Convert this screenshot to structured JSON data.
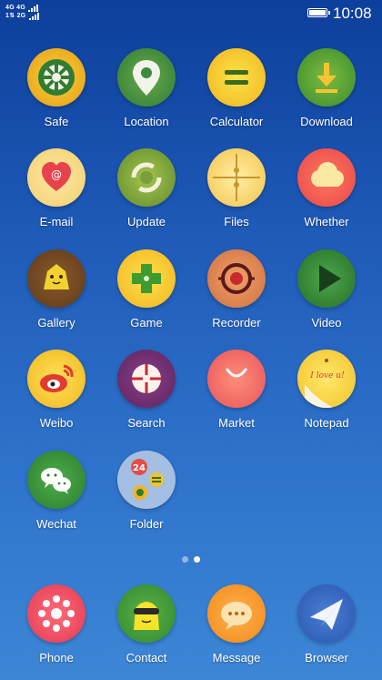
{
  "status_bar": {
    "network_top": "4G 4G",
    "network_bottom": "1⇅ 2G",
    "time": "10:08"
  },
  "apps": [
    {
      "label": "Safe",
      "icon": "safe-icon"
    },
    {
      "label": "Location",
      "icon": "location-pin-icon"
    },
    {
      "label": "Calculator",
      "icon": "calculator-icon"
    },
    {
      "label": "Download",
      "icon": "download-icon"
    },
    {
      "label": "E-mail",
      "icon": "email-heart-icon"
    },
    {
      "label": "Update",
      "icon": "update-icon"
    },
    {
      "label": "Files",
      "icon": "files-icon"
    },
    {
      "label": "Whether",
      "icon": "cloud-icon"
    },
    {
      "label": "Gallery",
      "icon": "gallery-icon"
    },
    {
      "label": "Game",
      "icon": "gamepad-icon"
    },
    {
      "label": "Recorder",
      "icon": "recorder-icon"
    },
    {
      "label": "Video",
      "icon": "play-icon"
    },
    {
      "label": "Weibo",
      "icon": "weibo-icon"
    },
    {
      "label": "Search",
      "icon": "crosshair-icon"
    },
    {
      "label": "Market",
      "icon": "smile-icon"
    },
    {
      "label": "Notepad",
      "icon": "notepad-icon"
    },
    {
      "label": "Wechat",
      "icon": "wechat-icon"
    },
    {
      "label": "Folder",
      "icon": "folder-icon"
    }
  ],
  "folder_badge": "24",
  "notepad_text": "I love u!",
  "page_indicator": {
    "pages": 2,
    "current": 2
  },
  "dock": [
    {
      "label": "Phone",
      "icon": "phone-dialpad-icon"
    },
    {
      "label": "Contact",
      "icon": "contact-icon"
    },
    {
      "label": "Message",
      "icon": "message-icon"
    },
    {
      "label": "Browser",
      "icon": "paper-plane-icon"
    }
  ],
  "colors": {
    "background_top": "#0d3f9c",
    "background_bottom": "#3d86d6"
  }
}
